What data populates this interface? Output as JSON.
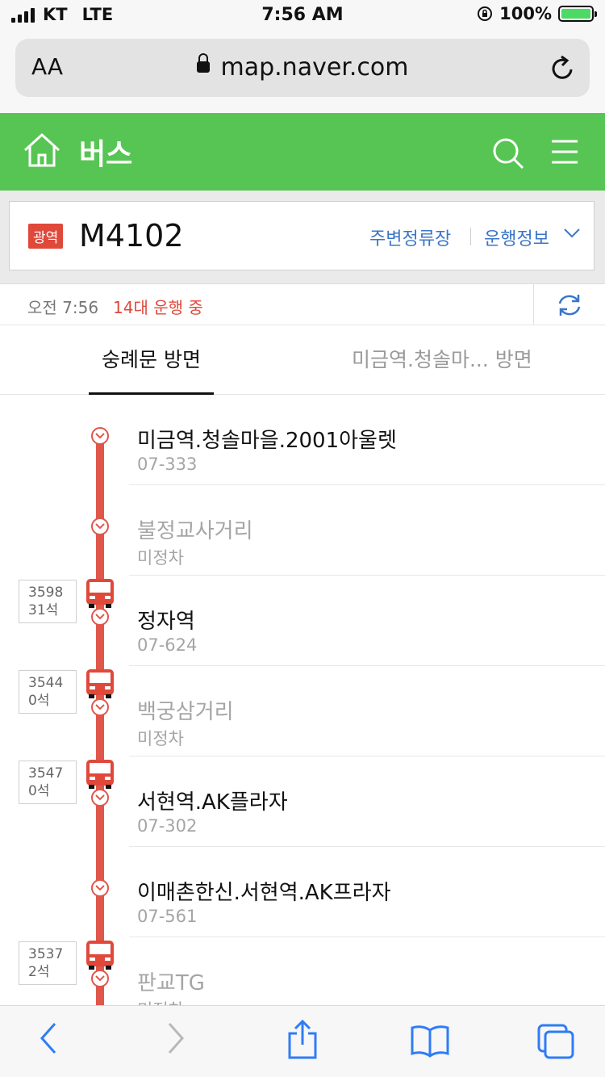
{
  "status_bar": {
    "carrier": "KT",
    "network": "LTE",
    "time": "7:56 AM",
    "battery": "100%"
  },
  "browser": {
    "text_size_label": "AA",
    "url": "map.naver.com"
  },
  "header": {
    "title": "버스"
  },
  "route": {
    "badge": "광역",
    "number": "M4102",
    "nearby_stops_link": "주변정류장",
    "operation_info_link": "운행정보"
  },
  "status": {
    "time": "오전 7:56",
    "running": "14대 운행 중"
  },
  "tabs": [
    {
      "label": "숭례문 방면",
      "selected": true
    },
    {
      "label": "미금역.청솔마... 방면",
      "selected": false
    }
  ],
  "stops": [
    {
      "name": "미금역.청솔마을.2001아울렛",
      "code": "07-333",
      "dimmed": false
    },
    {
      "name": "불정교사거리",
      "code": "미정차",
      "dimmed": true
    },
    {
      "name": "정자역",
      "code": "07-624",
      "dimmed": false
    },
    {
      "name": "백궁삼거리",
      "code": "미정차",
      "dimmed": true
    },
    {
      "name": "서현역.AK플라자",
      "code": "07-302",
      "dimmed": false
    },
    {
      "name": "이매촌한신.서현역.AK프라자",
      "code": "07-561",
      "dimmed": false
    },
    {
      "name": "판교TG",
      "code": "미정차",
      "dimmed": true
    }
  ],
  "buses": [
    {
      "vehicle": "3598",
      "seats": "31석"
    },
    {
      "vehicle": "3544",
      "seats": "0석"
    },
    {
      "vehicle": "3547",
      "seats": "0석"
    },
    {
      "vehicle": "3537",
      "seats": "2석"
    }
  ],
  "colors": {
    "header_green": "#57c553",
    "route_red": "#e0564b",
    "link_blue": "#3a76c7",
    "badge_red": "#e0483a"
  }
}
